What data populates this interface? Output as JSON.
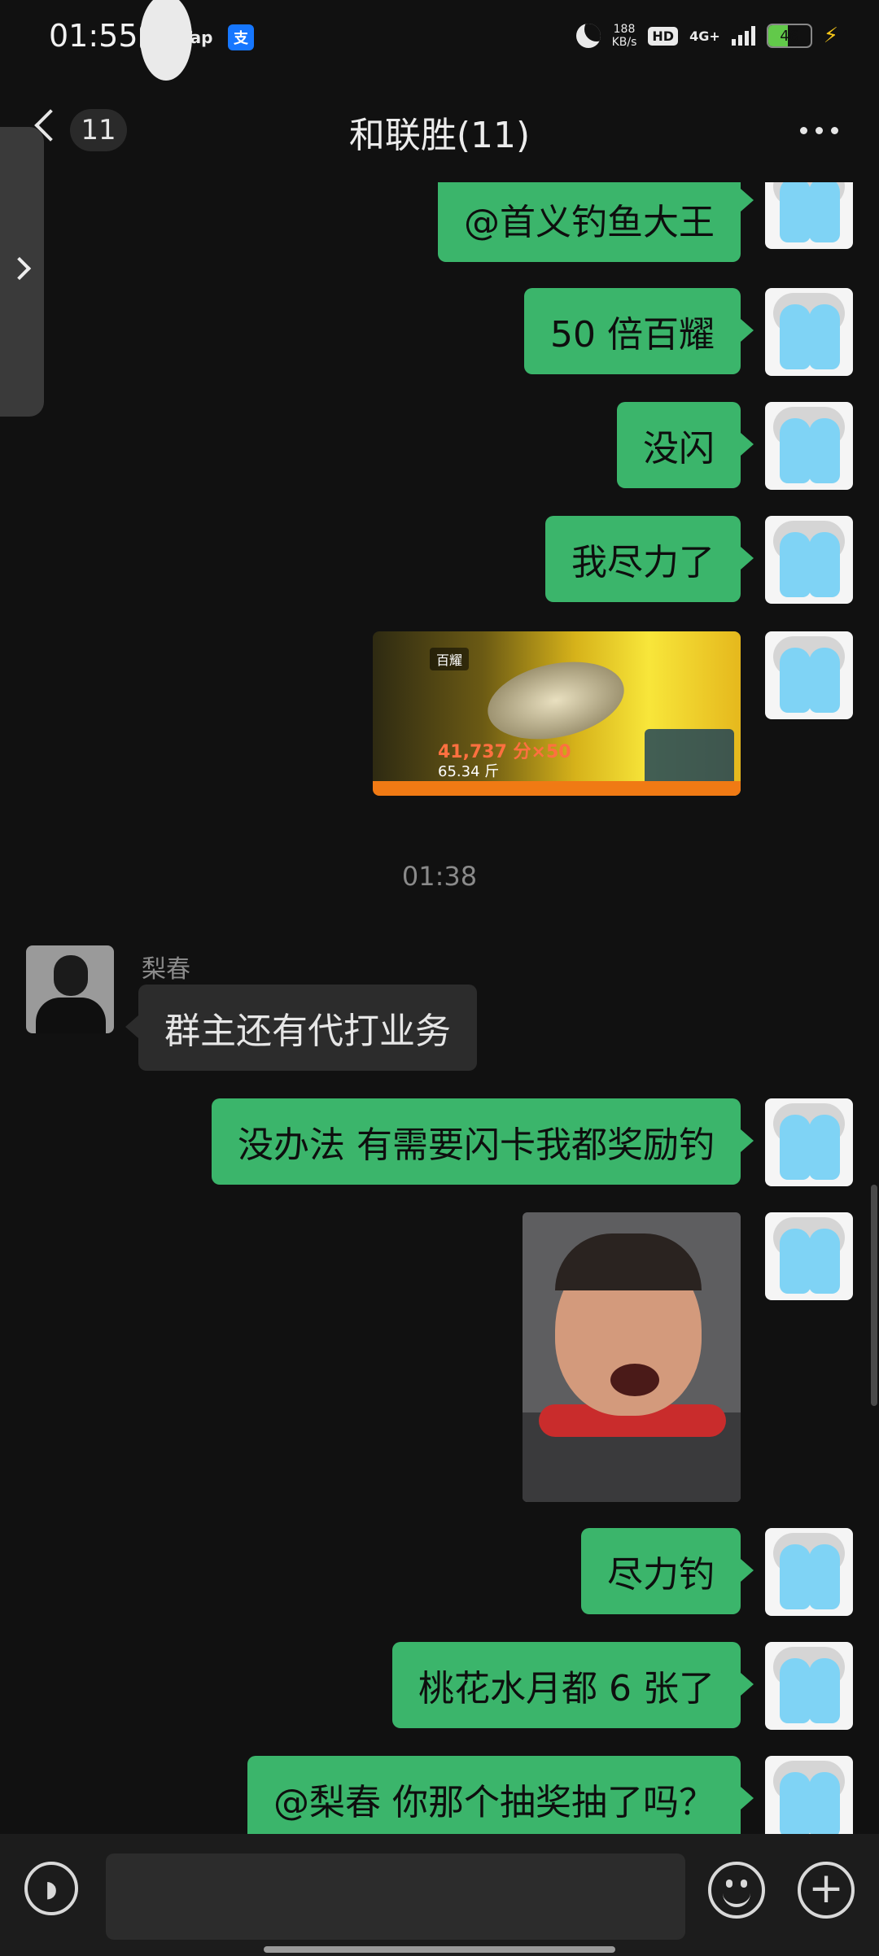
{
  "status_bar": {
    "time": "01:55",
    "app_icons": [
      "wechat-icon",
      "taptap-icon",
      "message-bubble-icon",
      "alipay-icon"
    ],
    "tap_label": "Tap",
    "alipay_label": "支",
    "speed_value": "188",
    "speed_unit": "KB/s",
    "hd_label": "HD",
    "network": "4G+",
    "battery_level": "46",
    "battery_fraction": 0.46
  },
  "header": {
    "unread_count": "11",
    "title": "和联胜(11)"
  },
  "messages": {
    "m1": "@首义钓鱼大王",
    "m2": "50 倍百耀",
    "m3": "没闪",
    "m4": "我尽力了",
    "game_image": {
      "label": "百耀",
      "score": "41,737 分×50",
      "weight": "65.34 斤"
    },
    "timestamp": "01:38",
    "sender_name": "梨春",
    "m5": "群主还有代打业务",
    "m6": "没办法 有需要闪卡我都奖励钓",
    "m7": "尽力钓",
    "m8": "桃花水月都 6 张了",
    "m9": "@梨春  你那个抽奖抽了吗？"
  },
  "colors": {
    "background": "#111111",
    "self_bubble": "#3bb56b",
    "other_bubble": "#2c2c2c"
  }
}
